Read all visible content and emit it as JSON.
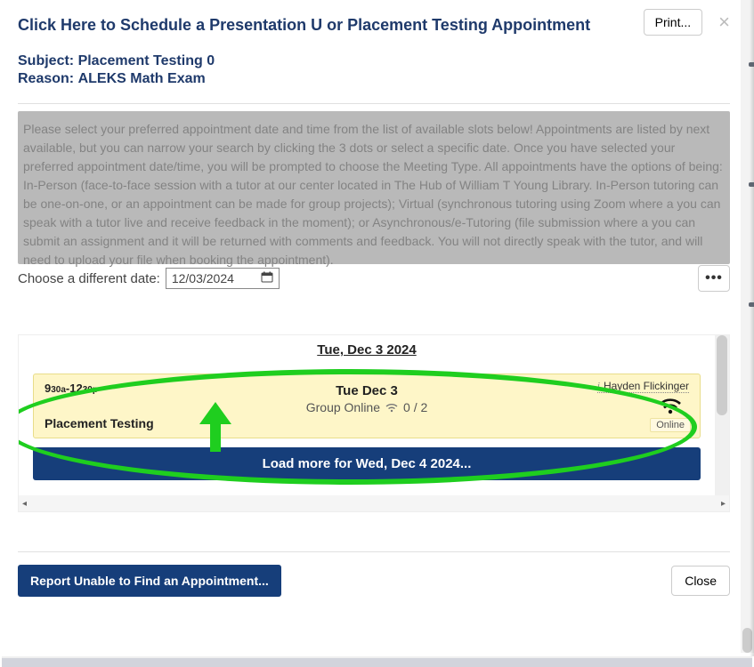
{
  "header": {
    "title": "Click Here to Schedule a Presentation U or Placement Testing Appointment",
    "print_label": "Print...",
    "close_x": "×"
  },
  "subject": {
    "label": "Subject: ",
    "value": "Placement Testing 0"
  },
  "reason": {
    "label": "Reason: ",
    "value": "ALEKS Math Exam"
  },
  "info_text": "Please select your preferred appointment date and time from the list of available slots below! Appointments are listed by next available, but you can narrow your search by clicking the 3 dots or select a specific date. Once you have selected your preferred appointment date/time, you will be prompted to choose the Meeting Type. All appointments have the options of being: In-Person (face-to-face session with a tutor at our center located in The Hub of William T Young Library. In-Person tutoring can be one-on-one, or an appointment can be made for group projects); Virtual (synchronous tutoring using Zoom where a you can speak with a tutor live and receive feedback in the moment); or Asynchronous/e-Tutoring (file submission where a you can submit an assignment and it will be returned with comments and feedback. You will not directly speak with the tutor, and will need to upload your file when booking the appointment).",
  "date_picker": {
    "label": "Choose a different date:",
    "value": "12/03/2024",
    "dots": "•••"
  },
  "schedule": {
    "date_heading": "Tue, Dec 3 2024",
    "slot": {
      "time_start_h": "9",
      "time_start_m": "30a",
      "time_dash": "-",
      "time_end_h": "12",
      "time_end_m": "30p",
      "card_title": "Tue Dec 3",
      "group_label": "Group Online",
      "capacity": "0 / 2",
      "tutor": "Hayden Flickinger",
      "type_badge": "Online",
      "service_name": "Placement Testing"
    },
    "load_more": "Load more for Wed, Dec 4 2024..."
  },
  "footer": {
    "report_label": "Report Unable to Find an Appointment...",
    "close_label": "Close"
  },
  "icons": {
    "calendar": "calendar-icon",
    "wifi_small": "wifi-icon",
    "wifi_large": "wifi-icon",
    "info": "i"
  }
}
